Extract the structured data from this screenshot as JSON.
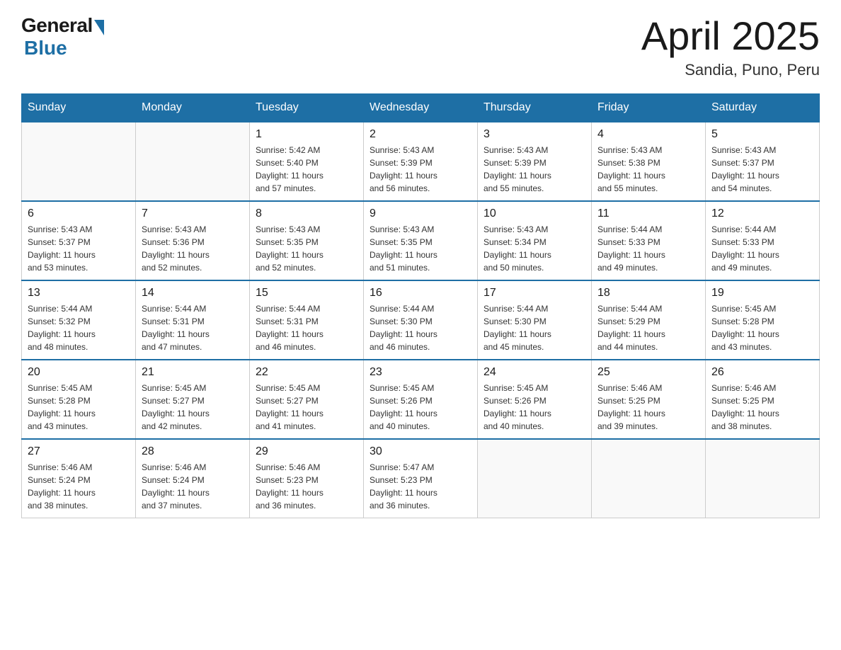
{
  "logo": {
    "general": "General",
    "blue": "Blue"
  },
  "title": {
    "month": "April 2025",
    "location": "Sandia, Puno, Peru"
  },
  "weekdays": [
    "Sunday",
    "Monday",
    "Tuesday",
    "Wednesday",
    "Thursday",
    "Friday",
    "Saturday"
  ],
  "weeks": [
    [
      {
        "day": "",
        "info": ""
      },
      {
        "day": "",
        "info": ""
      },
      {
        "day": "1",
        "info": "Sunrise: 5:42 AM\nSunset: 5:40 PM\nDaylight: 11 hours\nand 57 minutes."
      },
      {
        "day": "2",
        "info": "Sunrise: 5:43 AM\nSunset: 5:39 PM\nDaylight: 11 hours\nand 56 minutes."
      },
      {
        "day": "3",
        "info": "Sunrise: 5:43 AM\nSunset: 5:39 PM\nDaylight: 11 hours\nand 55 minutes."
      },
      {
        "day": "4",
        "info": "Sunrise: 5:43 AM\nSunset: 5:38 PM\nDaylight: 11 hours\nand 55 minutes."
      },
      {
        "day": "5",
        "info": "Sunrise: 5:43 AM\nSunset: 5:37 PM\nDaylight: 11 hours\nand 54 minutes."
      }
    ],
    [
      {
        "day": "6",
        "info": "Sunrise: 5:43 AM\nSunset: 5:37 PM\nDaylight: 11 hours\nand 53 minutes."
      },
      {
        "day": "7",
        "info": "Sunrise: 5:43 AM\nSunset: 5:36 PM\nDaylight: 11 hours\nand 52 minutes."
      },
      {
        "day": "8",
        "info": "Sunrise: 5:43 AM\nSunset: 5:35 PM\nDaylight: 11 hours\nand 52 minutes."
      },
      {
        "day": "9",
        "info": "Sunrise: 5:43 AM\nSunset: 5:35 PM\nDaylight: 11 hours\nand 51 minutes."
      },
      {
        "day": "10",
        "info": "Sunrise: 5:43 AM\nSunset: 5:34 PM\nDaylight: 11 hours\nand 50 minutes."
      },
      {
        "day": "11",
        "info": "Sunrise: 5:44 AM\nSunset: 5:33 PM\nDaylight: 11 hours\nand 49 minutes."
      },
      {
        "day": "12",
        "info": "Sunrise: 5:44 AM\nSunset: 5:33 PM\nDaylight: 11 hours\nand 49 minutes."
      }
    ],
    [
      {
        "day": "13",
        "info": "Sunrise: 5:44 AM\nSunset: 5:32 PM\nDaylight: 11 hours\nand 48 minutes."
      },
      {
        "day": "14",
        "info": "Sunrise: 5:44 AM\nSunset: 5:31 PM\nDaylight: 11 hours\nand 47 minutes."
      },
      {
        "day": "15",
        "info": "Sunrise: 5:44 AM\nSunset: 5:31 PM\nDaylight: 11 hours\nand 46 minutes."
      },
      {
        "day": "16",
        "info": "Sunrise: 5:44 AM\nSunset: 5:30 PM\nDaylight: 11 hours\nand 46 minutes."
      },
      {
        "day": "17",
        "info": "Sunrise: 5:44 AM\nSunset: 5:30 PM\nDaylight: 11 hours\nand 45 minutes."
      },
      {
        "day": "18",
        "info": "Sunrise: 5:44 AM\nSunset: 5:29 PM\nDaylight: 11 hours\nand 44 minutes."
      },
      {
        "day": "19",
        "info": "Sunrise: 5:45 AM\nSunset: 5:28 PM\nDaylight: 11 hours\nand 43 minutes."
      }
    ],
    [
      {
        "day": "20",
        "info": "Sunrise: 5:45 AM\nSunset: 5:28 PM\nDaylight: 11 hours\nand 43 minutes."
      },
      {
        "day": "21",
        "info": "Sunrise: 5:45 AM\nSunset: 5:27 PM\nDaylight: 11 hours\nand 42 minutes."
      },
      {
        "day": "22",
        "info": "Sunrise: 5:45 AM\nSunset: 5:27 PM\nDaylight: 11 hours\nand 41 minutes."
      },
      {
        "day": "23",
        "info": "Sunrise: 5:45 AM\nSunset: 5:26 PM\nDaylight: 11 hours\nand 40 minutes."
      },
      {
        "day": "24",
        "info": "Sunrise: 5:45 AM\nSunset: 5:26 PM\nDaylight: 11 hours\nand 40 minutes."
      },
      {
        "day": "25",
        "info": "Sunrise: 5:46 AM\nSunset: 5:25 PM\nDaylight: 11 hours\nand 39 minutes."
      },
      {
        "day": "26",
        "info": "Sunrise: 5:46 AM\nSunset: 5:25 PM\nDaylight: 11 hours\nand 38 minutes."
      }
    ],
    [
      {
        "day": "27",
        "info": "Sunrise: 5:46 AM\nSunset: 5:24 PM\nDaylight: 11 hours\nand 38 minutes."
      },
      {
        "day": "28",
        "info": "Sunrise: 5:46 AM\nSunset: 5:24 PM\nDaylight: 11 hours\nand 37 minutes."
      },
      {
        "day": "29",
        "info": "Sunrise: 5:46 AM\nSunset: 5:23 PM\nDaylight: 11 hours\nand 36 minutes."
      },
      {
        "day": "30",
        "info": "Sunrise: 5:47 AM\nSunset: 5:23 PM\nDaylight: 11 hours\nand 36 minutes."
      },
      {
        "day": "",
        "info": ""
      },
      {
        "day": "",
        "info": ""
      },
      {
        "day": "",
        "info": ""
      }
    ]
  ]
}
